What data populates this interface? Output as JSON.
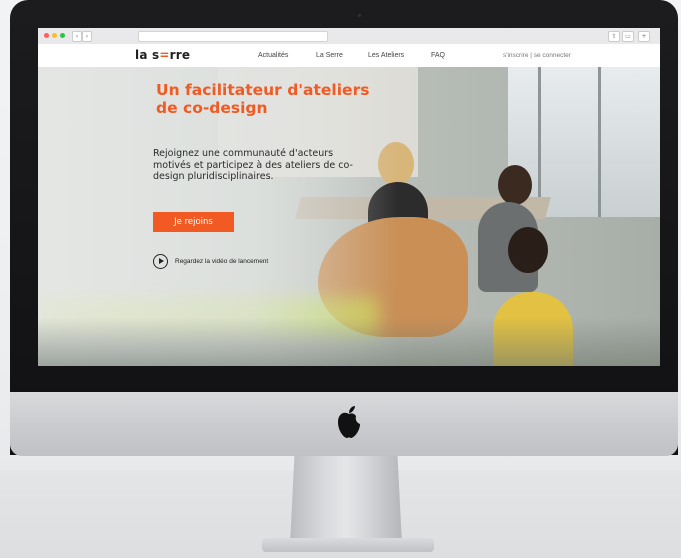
{
  "header": {
    "logo": {
      "part1": "la s",
      "accent": "=",
      "part2": "rre"
    },
    "nav": [
      "Actualités",
      "La Serre",
      "Les Ateliers",
      "FAQ"
    ],
    "auth": "s'inscrire | se connecter"
  },
  "hero": {
    "headline": "Un facilitateur d'ateliers de co-design",
    "subtext": "Rejoignez une communauté d'acteurs motivés et participez à des ateliers de co-design pluridisciplinaires.",
    "cta_label": "Je rejoins",
    "video_label": "Regardez la vidéo de lancement"
  },
  "colors": {
    "accent": "#f15a22",
    "bezel": "#111113",
    "aluminum": "#c9cbce"
  },
  "icons": {
    "apple": "apple-logo",
    "play": "play-circle-icon"
  }
}
